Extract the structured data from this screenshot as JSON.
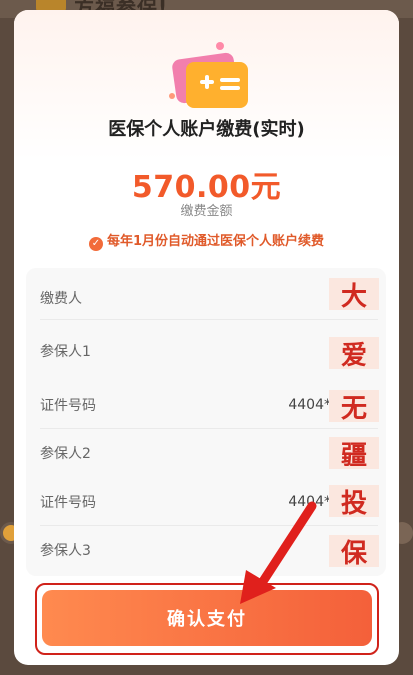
{
  "background": {
    "partial_title": "方福参保!"
  },
  "modal": {
    "title": "医保个人账户缴费(实时)",
    "amount": "570.00元",
    "amount_label": "缴费金额",
    "notice": "每年1月份自动通过医保个人账户续费",
    "details": [
      {
        "label": "缴费人",
        "value": ""
      },
      {
        "label": "参保人1",
        "value": ""
      },
      {
        "label": "证件号码",
        "value": "4404****"
      },
      {
        "label": "参保人2",
        "value": ""
      },
      {
        "label": "证件号码",
        "value": "4404****"
      },
      {
        "label": "参保人3",
        "value": ""
      }
    ],
    "stamp_chars": [
      "大",
      "爱",
      "无",
      "疆",
      "投",
      "保"
    ],
    "confirm_label": "确认支付"
  },
  "colors": {
    "accent": "#f25a2a",
    "button_start": "#ff8a4f",
    "button_end": "#f4603a",
    "highlight_frame": "#d0221a"
  },
  "icons": {
    "illustration": "card-illustration-icon",
    "check": "check-circle-icon",
    "arrow": "red-arrow-annotation"
  }
}
